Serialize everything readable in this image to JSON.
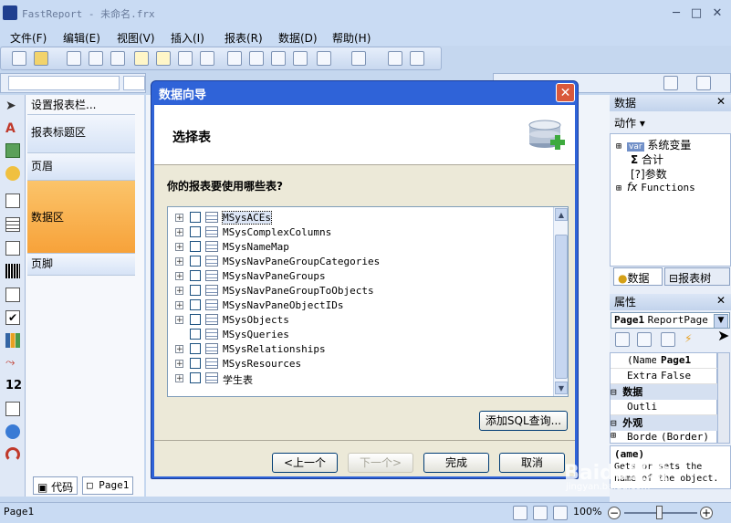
{
  "window": {
    "title": "FastReport - 未命名.frx",
    "min": "─",
    "max": "□",
    "close": "✕"
  },
  "menu": [
    "文件(F)",
    "编辑(E)",
    "视图(V)",
    "插入(I)",
    "报表(R)",
    "数据(D)",
    "帮助(H)"
  ],
  "bands": {
    "setup": "设置报表栏...",
    "report_title": "报表标题区",
    "page_header": "页眉",
    "data": "数据区",
    "page_footer": "页脚"
  },
  "bottom_tabs": {
    "code": "代码",
    "page": "Page1"
  },
  "status": {
    "page": "Page1",
    "zoom": "100%"
  },
  "data_panel": {
    "title": "数据",
    "actions": "动作",
    "tree": [
      "系统变量",
      "合计",
      "参数",
      "Functions"
    ],
    "tabs": [
      "数据",
      "报表树"
    ]
  },
  "props_panel": {
    "title": "属性",
    "object": "Page1",
    "object_type": "ReportPage",
    "rows": [
      {
        "name": "(Name)",
        "value": "Page1"
      },
      {
        "name": "Extra",
        "value": "False"
      }
    ],
    "cat_data": "数据",
    "outline": "Outlii",
    "cat_look": "外观",
    "border_row": {
      "name": "Border",
      "value": "(Border)"
    },
    "desc_title": "(ame)",
    "desc_text": "Gets or sets the name of the object."
  },
  "dialog": {
    "title": "数据向导",
    "header": "选择表",
    "question": "你的报表要使用哪些表?",
    "tables": [
      {
        "name": "MSysACEs",
        "expandable": true,
        "selected": true
      },
      {
        "name": "MSysComplexColumns",
        "expandable": true
      },
      {
        "name": "MSysNameMap",
        "expandable": true
      },
      {
        "name": "MSysNavPaneGroupCategories",
        "expandable": true
      },
      {
        "name": "MSysNavPaneGroups",
        "expandable": true
      },
      {
        "name": "MSysNavPaneGroupToObjects",
        "expandable": true
      },
      {
        "name": "MSysNavPaneObjectIDs",
        "expandable": true
      },
      {
        "name": "MSysObjects",
        "expandable": true
      },
      {
        "name": "MSysQueries",
        "expandable": false
      },
      {
        "name": "MSysRelationships",
        "expandable": true
      },
      {
        "name": "MSysResources",
        "expandable": true
      },
      {
        "name": "学生表",
        "expandable": true
      }
    ],
    "add_sql": "添加SQL查询...",
    "prev": "<上一个",
    "next": "下一个>",
    "finish": "完成",
    "cancel": "取消"
  },
  "watermark": "Baidu经验",
  "watermark_url": "jingyan.baidu.com"
}
